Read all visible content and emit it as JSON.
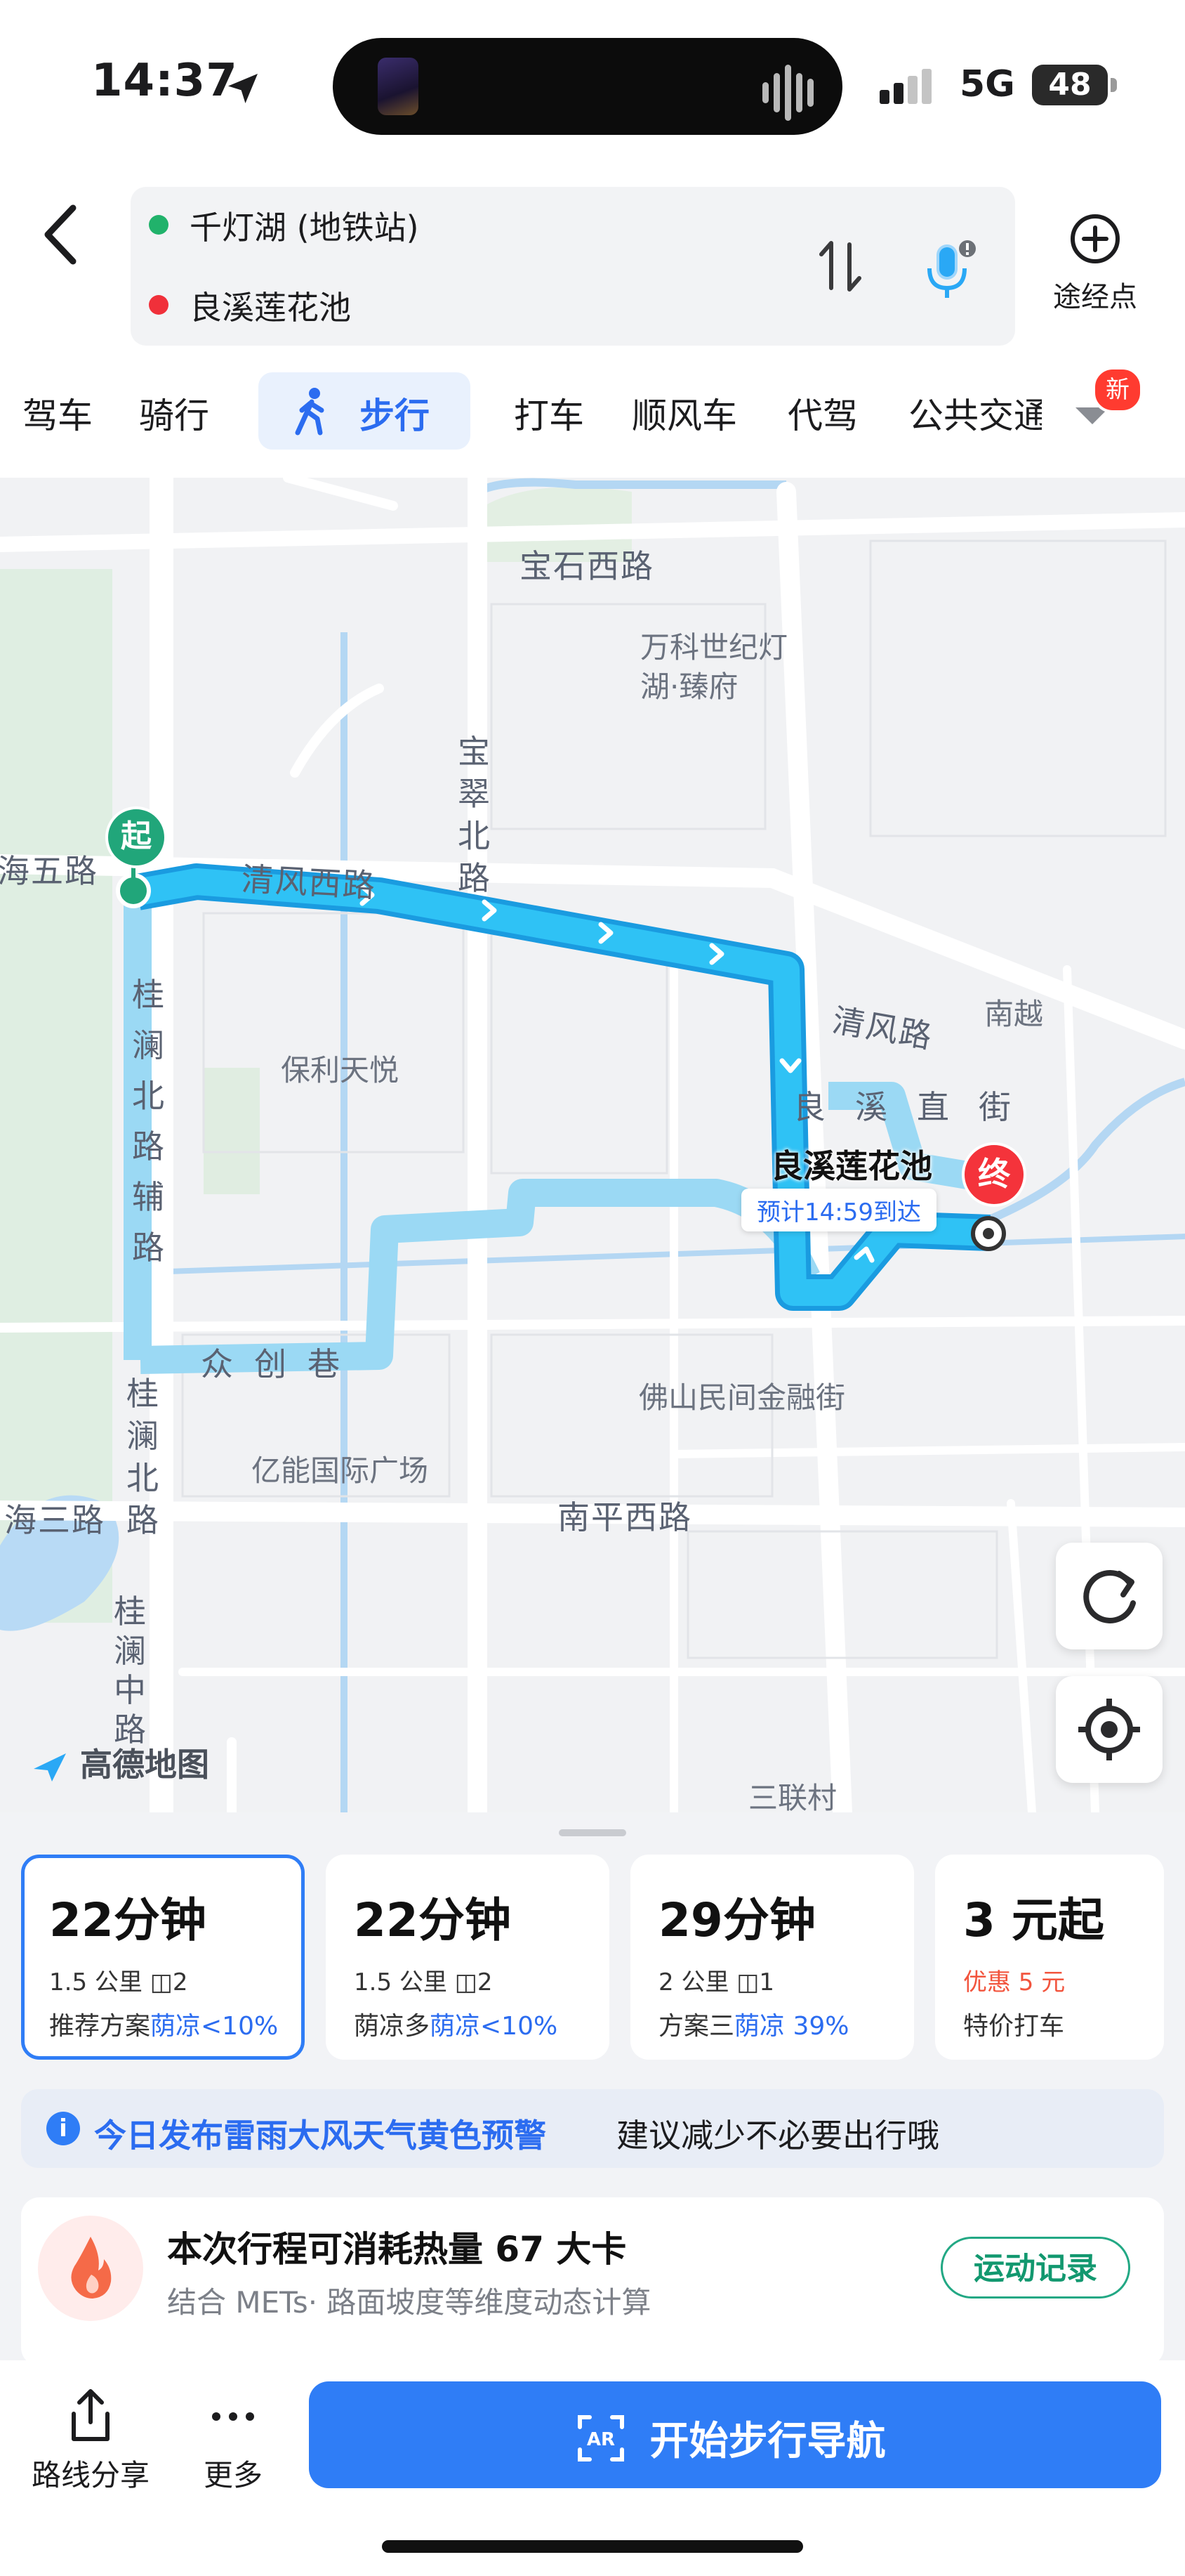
{
  "status_bar": {
    "time": "14:37",
    "network": "5G",
    "battery": "48"
  },
  "route": {
    "origin": "千灯湖 (地铁站)",
    "destination": "良溪莲花池",
    "via_label": "途经点"
  },
  "modes": {
    "tabs": [
      "驾车",
      "骑行",
      "步行",
      "打车",
      "顺风车",
      "代驾",
      "公共交通"
    ],
    "active": "步行",
    "new_badge": "新"
  },
  "map": {
    "labels": {
      "baoshi_xilu": "宝石西路",
      "wanke": "万科世纪灯湖·臻府",
      "baocui_beilu": "宝翠北路",
      "qingfeng_xilu": "清风西路",
      "haiwu_lu": "海五路",
      "qingfeng_lu": "清风路",
      "nanyue": "南越",
      "guilan_beilu_fudao": "桂澜北路辅路",
      "baoli_tianyue": "保利天悦",
      "liangxi_zhijie": "良溪直街",
      "zhongchuang_xiang": "众创巷",
      "foshan_jinrong": "佛山民间金融街",
      "guilan_beilu": "桂澜北路",
      "yineng": "亿能国际广场",
      "haisan_lu": "海三路",
      "nanping_xilu": "南平西路",
      "guilan_zhonglu": "桂澜中路",
      "sanlian": "三联村"
    },
    "dest_name": "良溪莲花池",
    "eta": "预计14:59到达",
    "start_pin": "起",
    "end_pin": "终",
    "logo": "高德地图"
  },
  "options": [
    {
      "time": "22分钟",
      "distance": "1.5 公里",
      "lights": "2",
      "label": "推荐方案",
      "shade": "荫凉<10%",
      "selected": true
    },
    {
      "time": "22分钟",
      "distance": "1.5 公里",
      "lights": "2",
      "label": "荫凉多",
      "shade": "荫凉<10%",
      "selected": false
    },
    {
      "time": "29分钟",
      "distance": "2 公里",
      "lights": "1",
      "label": "方案三",
      "shade": "荫凉 39%",
      "selected": false
    },
    {
      "time": "3 元起",
      "discount": "优惠 5 元",
      "label": "特价打车",
      "selected": false
    }
  ],
  "notice": {
    "title": "今日发布雷雨大风天气黄色预警",
    "text": "建议减少不必要出行哦"
  },
  "calorie": {
    "title": "本次行程可消耗热量 67 大卡",
    "subtitle": "结合 METs· 路面坡度等维度动态计算",
    "button": "运动记录"
  },
  "actions": {
    "share": "路线分享",
    "more": "更多",
    "start": "开始步行导航"
  },
  "colors": {
    "accent": "#2f7df6",
    "route": "#2bb3ee",
    "start_pin": "#21a67a",
    "end_pin": "#f4333b",
    "green_btn": "#22a884"
  }
}
